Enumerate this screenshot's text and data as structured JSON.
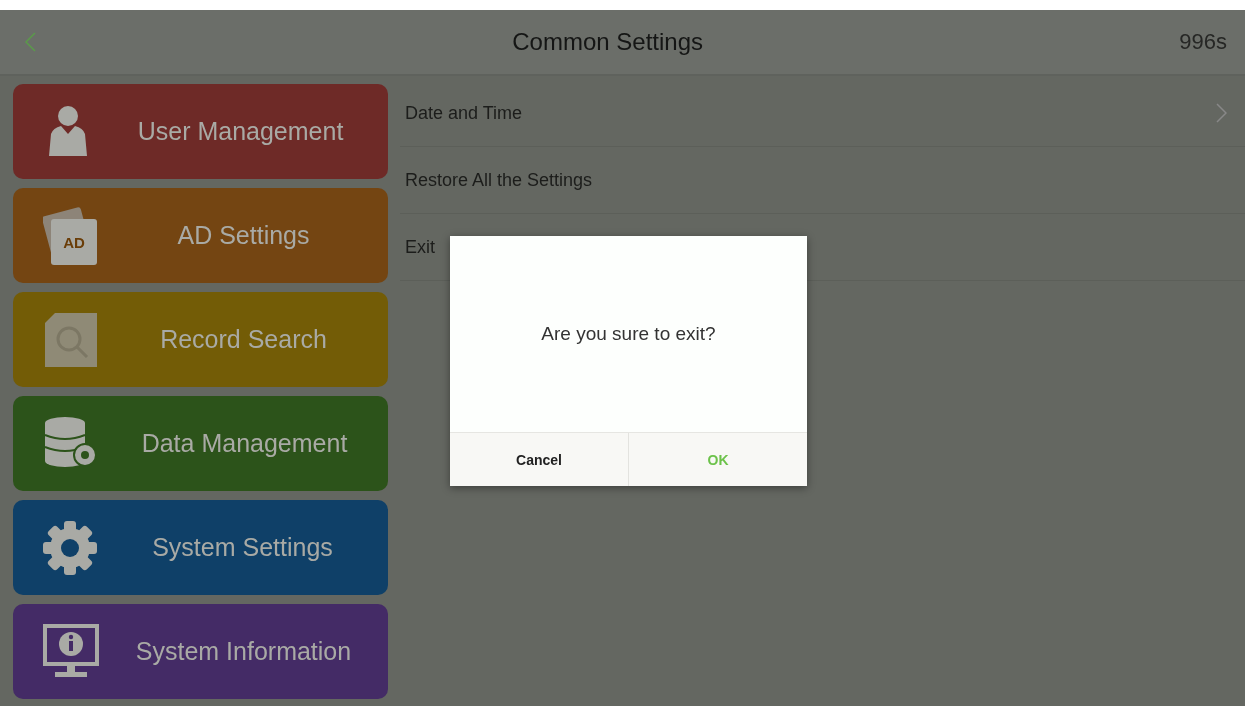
{
  "header": {
    "title": "Common Settings",
    "countdown": "996s"
  },
  "menu": [
    {
      "label": "User Management",
      "color": "#6e2a27"
    },
    {
      "label": "AD Settings",
      "color": "#744512",
      "badge": "AD"
    },
    {
      "label": "Record Search",
      "color": "#735c06"
    },
    {
      "label": "Data Management",
      "color": "#2c531a"
    },
    {
      "label": "System Settings",
      "color": "#0f4068"
    },
    {
      "label": "System Information",
      "color": "#442b66"
    }
  ],
  "settings": [
    {
      "label": "Date and Time",
      "arrow": true
    },
    {
      "label": "Restore All the Settings",
      "arrow": false
    },
    {
      "label": "Exit",
      "arrow": false
    }
  ],
  "dialog": {
    "message": "Are you sure to exit?",
    "buttons": [
      {
        "label": "Cancel",
        "kind": "cancel"
      },
      {
        "label": "OK",
        "kind": "confirm"
      }
    ]
  }
}
